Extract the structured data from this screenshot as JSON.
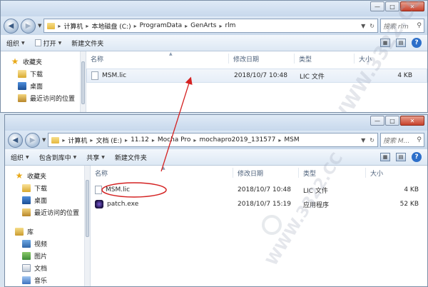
{
  "colors": {
    "accent": "#2d6fc9",
    "annotation": "#d42222",
    "window_border": "#7a8ea6"
  },
  "window_back": {
    "path": [
      "计算机",
      "本地磁盘 (C:)",
      "ProgramData",
      "GenArts",
      "rlm"
    ],
    "search_placeholder": "搜索 rlm",
    "toolbar": {
      "organize": "组织",
      "open": "打开",
      "new_folder": "新建文件夹"
    },
    "nav": {
      "favorites": "收藏夹",
      "downloads": "下载",
      "desktop": "桌面",
      "recent": "最近访问的位置"
    },
    "columns": {
      "name": "名称",
      "date": "修改日期",
      "type": "类型",
      "size": "大小"
    },
    "files": [
      {
        "name": "MSM.lic",
        "date": "2018/10/7 10:48",
        "type": "LIC 文件",
        "size": "4 KB"
      }
    ]
  },
  "window_front": {
    "path": [
      "计算机",
      "文档 (E:)",
      "11.12",
      "Mocha Pro",
      "mochapro2019_131577",
      "MSM"
    ],
    "search_placeholder": "搜索 M...",
    "toolbar": {
      "organize": "组织",
      "include": "包含到库中",
      "share": "共享",
      "new_folder": "新建文件夹"
    },
    "nav": {
      "favorites": "收藏夹",
      "downloads": "下载",
      "desktop": "桌面",
      "recent": "最近访问的位置",
      "library": "库",
      "videos": "视频",
      "pictures": "图片",
      "documents": "文档",
      "music": "音乐"
    },
    "columns": {
      "name": "名称",
      "date": "修改日期",
      "type": "类型",
      "size": "大小"
    },
    "files": [
      {
        "name": "MSM.lic",
        "date": "2018/10/7 10:48",
        "type": "LIC 文件",
        "size": "4 KB"
      },
      {
        "name": "patch.exe",
        "date": "2018/10/7 15:19",
        "type": "应用程序",
        "size": "52 KB"
      }
    ]
  },
  "watermark": {
    "text": "WWW.3322.CC"
  }
}
